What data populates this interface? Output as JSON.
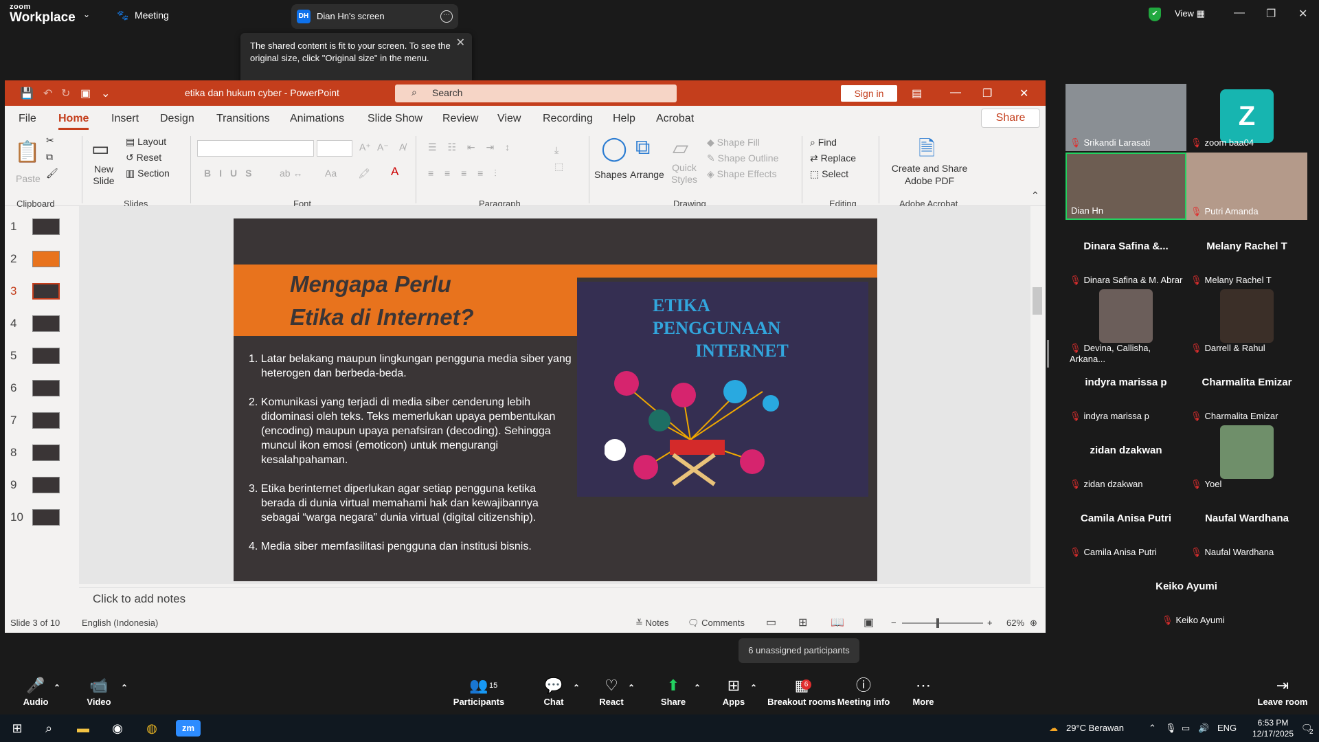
{
  "zoom": {
    "logo_line1": "zoom",
    "logo_line2": "Workplace",
    "meeting_label": "Meeting",
    "shared_tab": {
      "initials": "DH",
      "label": "Dian Hn's screen"
    },
    "tooltip": "The shared content is fit to your screen. To see the original size, click \"Original size\" in the menu.",
    "view_label": "View",
    "unassigned": "6 unassigned participants",
    "bottom": [
      {
        "label": "Audio",
        "icon": "🎤"
      },
      {
        "label": "Video",
        "icon": "📹"
      },
      {
        "label": "Participants",
        "icon": "👥",
        "count": "15"
      },
      {
        "label": "Chat",
        "icon": "💬"
      },
      {
        "label": "React",
        "icon": "♡"
      },
      {
        "label": "Share",
        "icon": "⬆"
      },
      {
        "label": "Apps",
        "icon": "⊞"
      },
      {
        "label": "Breakout rooms",
        "icon": "▦",
        "badge": "6"
      },
      {
        "label": "Meeting info",
        "icon": "ⓘ"
      },
      {
        "label": "More",
        "icon": "⋯"
      },
      {
        "label": "Leave room",
        "icon": "⇥"
      }
    ]
  },
  "ppt": {
    "title": "etika dan hukum cyber  -  PowerPoint",
    "search_placeholder": "Search",
    "sign_in": "Sign in",
    "share": "Share",
    "menu": [
      "File",
      "Home",
      "Insert",
      "Design",
      "Transitions",
      "Animations",
      "Slide Show",
      "Review",
      "View",
      "Recording",
      "Help",
      "Acrobat"
    ],
    "ribbon": {
      "paste": "Paste",
      "clipboard": "Clipboard",
      "new_slide": "New Slide",
      "layout": "Layout",
      "reset": "Reset",
      "section": "Section",
      "slides": "Slides",
      "font": "Font",
      "paragraph": "Paragraph",
      "shapes": "Shapes",
      "arrange": "Arrange",
      "quick_styles": "Quick Styles",
      "shape_fill": "Shape Fill",
      "shape_outline": "Shape Outline",
      "shape_effects": "Shape Effects",
      "drawing": "Drawing",
      "find": "Find",
      "replace": "Replace",
      "select": "Select",
      "editing": "Editing",
      "create_pdf": "Create and Share Adobe PDF",
      "adobe_acrobat": "Adobe Acrobat"
    },
    "thumb_numbers": [
      "1",
      "2",
      "3",
      "4",
      "5",
      "6",
      "7",
      "8",
      "9",
      "10"
    ],
    "slide": {
      "title_line1": "Mengapa Perlu",
      "title_line2": "Etika di Internet?",
      "image_text_1": "ETIKA",
      "image_text_2": "PENGGUNAAN",
      "image_text_3": "INTERNET",
      "points": [
        "1. Latar belakang maupun lingkungan pengguna media siber yang heterogen dan berbeda-beda.",
        "2. Komunikasi yang terjadi di media siber cenderung lebih didominasi oleh teks. Teks memerlukan upaya pembentukan (encoding) maupun upaya penafsiran (decoding). Sehingga muncul ikon emosi (emoticon) untuk mengurangi kesalahpahaman.",
        "3. Etika berinternet diperlukan agar setiap pengguna ketika berada di dunia virtual memahami hak dan kewajibannya sebagai “warga negara” dunia virtual (digital citizenship).",
        "4. Media siber memfasilitasi pengguna dan institusi bisnis."
      ]
    },
    "notes_placeholder": "Click to add notes",
    "status": {
      "slide": "Slide 3 of 10",
      "language": "English (Indonesia)",
      "notes": "Notes",
      "comments": "Comments",
      "zoom": "62%"
    }
  },
  "gallery": {
    "video_tiles": [
      {
        "name": "Srikandi Larasati"
      },
      {
        "name": "zoom baa04",
        "initial": "Z"
      },
      {
        "name": "Dian Hn"
      },
      {
        "name": "Putri Amanda"
      }
    ],
    "tiles": [
      {
        "display": "Dinara Safina &...",
        "label": "Dinara Safina & M. Abrar"
      },
      {
        "display": "Melany Rachel T",
        "label": "Melany Rachel T"
      },
      {
        "display": "",
        "label": "Devina, Callisha, Arkana..."
      },
      {
        "display": "",
        "label": "Darrell & Rahul"
      },
      {
        "display": "indyra marissa p",
        "label": "indyra marissa p"
      },
      {
        "display": "Charmalita Emizar",
        "label": "Charmalita Emizar"
      },
      {
        "display": "zidan dzakwan",
        "label": "zidan dzakwan"
      },
      {
        "display": "",
        "label": "Yoel"
      },
      {
        "display": "Camila Anisa Putri",
        "label": "Camila Anisa Putri"
      },
      {
        "display": "Naufal Wardhana",
        "label": "Naufal Wardhana"
      },
      {
        "display": "Keiko Ayumi",
        "label": "Keiko Ayumi"
      }
    ]
  },
  "taskbar": {
    "weather": "29°C  Berawan",
    "lang": "ENG",
    "time": "6:53 PM",
    "date": "12/17/2025",
    "notif": "2"
  },
  "colors": {
    "ppt_accent": "#c43e1c",
    "slide_orange": "#e8731d",
    "zoom_blue": "#0e71eb"
  }
}
